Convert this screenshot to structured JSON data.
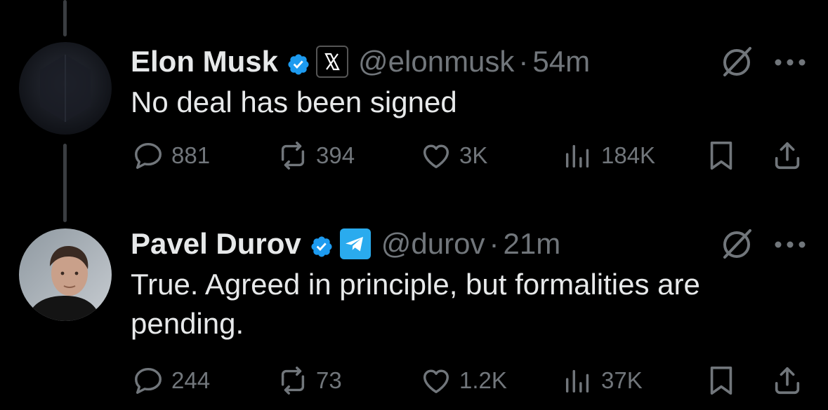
{
  "tweets": [
    {
      "author": "Elon Musk",
      "handle": "@elonmusk",
      "separator": "·",
      "time": "54m",
      "affiliation": "x-logo-icon",
      "text": "No deal has been signed",
      "stats": {
        "replies": "881",
        "reposts": "394",
        "likes": "3K",
        "views": "184K"
      }
    },
    {
      "author": "Pavel Durov",
      "handle": "@durov",
      "separator": "·",
      "time": "21m",
      "affiliation": "telegram-icon",
      "text": "True. Agreed in principle, but formalities are pending.",
      "stats": {
        "replies": "244",
        "reposts": "73",
        "likes": "1.2K",
        "views": "37K"
      }
    }
  ],
  "colors": {
    "background": "#000000",
    "text": "#e7e9ea",
    "muted": "#71767b",
    "verified": "#1d9bf0",
    "telegram": "#2aabee"
  }
}
